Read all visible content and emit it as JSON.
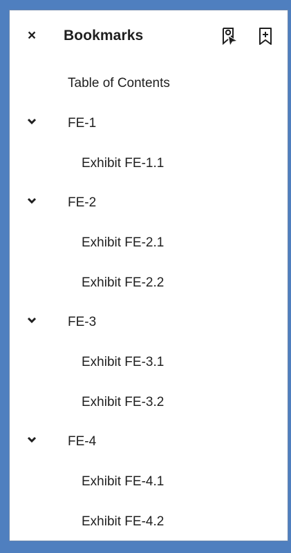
{
  "panel": {
    "title": "Bookmarks",
    "close_label": "×",
    "close_icon": "close-icon",
    "find_icon": "find-bookmark-icon",
    "add_icon": "add-bookmark-icon"
  },
  "bookmarks": {
    "toc": "Table of Contents",
    "fe1": {
      "label": "FE-1",
      "expanded": true,
      "children": [
        "Exhibit FE-1.1"
      ]
    },
    "fe2": {
      "label": "FE-2",
      "expanded": true,
      "children": [
        "Exhibit FE-2.1",
        "Exhibit FE-2.2"
      ]
    },
    "fe3": {
      "label": "FE-3",
      "expanded": true,
      "children": [
        "Exhibit FE-3.1",
        "Exhibit FE-3.2"
      ]
    },
    "fe4": {
      "label": "FE-4",
      "expanded": true,
      "children": [
        "Exhibit FE-4.1",
        "Exhibit FE-4.2"
      ]
    }
  },
  "colors": {
    "frame": "#4f7fbf",
    "panel_bg": "#ffffff",
    "text": "#1f1f1f"
  }
}
